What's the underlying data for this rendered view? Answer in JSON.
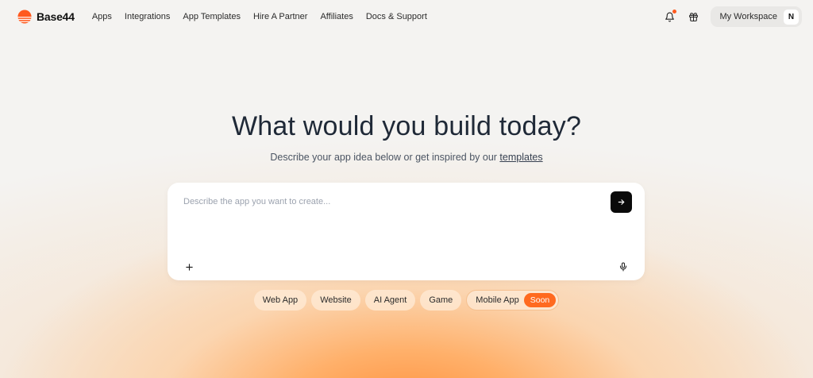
{
  "brand": {
    "name": "Base44",
    "accent": "#ff6a1f"
  },
  "nav": {
    "links": [
      "Apps",
      "Integrations",
      "App Templates",
      "Hire A Partner",
      "Affiliates",
      "Docs & Support"
    ],
    "workspace_label": "My Workspace",
    "avatar_initial": "N",
    "icons": [
      "bell-icon",
      "gift-icon"
    ]
  },
  "hero": {
    "title": "What would you build today?",
    "subtitle_prefix": "Describe your app idea below or get inspired by our ",
    "subtitle_link": "templates"
  },
  "prompt": {
    "placeholder": "Describe the app you want to create...",
    "value": ""
  },
  "chips": {
    "web_app": "Web App",
    "website": "Website",
    "ai_agent": "AI Agent",
    "game": "Game",
    "mobile_app": "Mobile App",
    "mobile_badge": "Soon"
  }
}
